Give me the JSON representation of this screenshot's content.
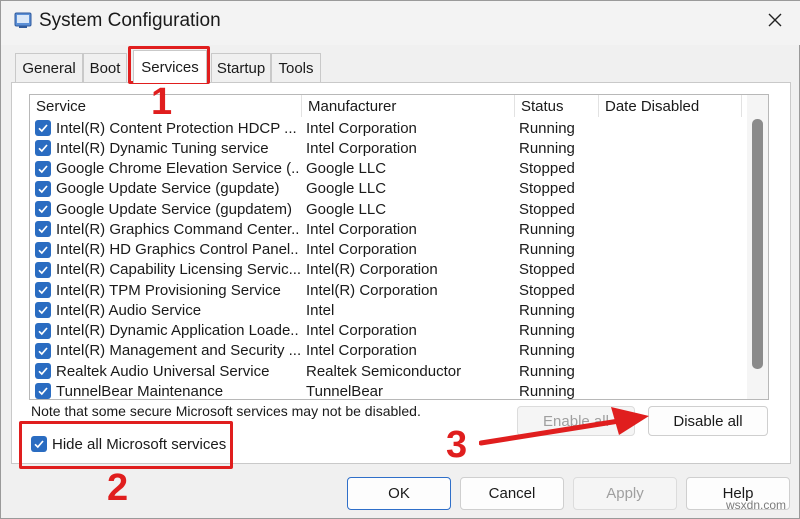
{
  "window": {
    "title": "System Configuration"
  },
  "tabs": [
    "General",
    "Boot",
    "Services",
    "Startup",
    "Tools"
  ],
  "active_tab": "Services",
  "columns": [
    "Service",
    "Manufacturer",
    "Status",
    "Date Disabled"
  ],
  "rows": [
    {
      "service": "Intel(R) Content Protection HDCP ...",
      "manufacturer": "Intel Corporation",
      "status": "Running",
      "date": ""
    },
    {
      "service": "Intel(R) Dynamic Tuning service",
      "manufacturer": "Intel Corporation",
      "status": "Running",
      "date": ""
    },
    {
      "service": "Google Chrome Elevation Service (...",
      "manufacturer": "Google LLC",
      "status": "Stopped",
      "date": ""
    },
    {
      "service": "Google Update Service (gupdate)",
      "manufacturer": "Google LLC",
      "status": "Stopped",
      "date": ""
    },
    {
      "service": "Google Update Service (gupdatem)",
      "manufacturer": "Google LLC",
      "status": "Stopped",
      "date": ""
    },
    {
      "service": "Intel(R) Graphics Command Center...",
      "manufacturer": "Intel Corporation",
      "status": "Running",
      "date": ""
    },
    {
      "service": "Intel(R) HD Graphics Control Panel...",
      "manufacturer": "Intel Corporation",
      "status": "Running",
      "date": ""
    },
    {
      "service": "Intel(R) Capability Licensing Servic...",
      "manufacturer": "Intel(R) Corporation",
      "status": "Stopped",
      "date": ""
    },
    {
      "service": "Intel(R) TPM Provisioning Service",
      "manufacturer": "Intel(R) Corporation",
      "status": "Stopped",
      "date": ""
    },
    {
      "service": "Intel(R) Audio Service",
      "manufacturer": "Intel",
      "status": "Running",
      "date": ""
    },
    {
      "service": "Intel(R) Dynamic Application Loade...",
      "manufacturer": "Intel Corporation",
      "status": "Running",
      "date": ""
    },
    {
      "service": "Intel(R) Management and Security ...",
      "manufacturer": "Intel Corporation",
      "status": "Running",
      "date": ""
    },
    {
      "service": "Realtek Audio Universal Service",
      "manufacturer": "Realtek Semiconductor",
      "status": "Running",
      "date": ""
    },
    {
      "service": "TunnelBear Maintenance",
      "manufacturer": "TunnelBear",
      "status": "Running",
      "date": ""
    }
  ],
  "note": "Note that some secure Microsoft services may not be disabled.",
  "enable_all": "Enable all",
  "disable_all": "Disable all",
  "hide_ms_label": "Hide all Microsoft services",
  "hide_ms_checked": true,
  "footer": {
    "ok": "OK",
    "cancel": "Cancel",
    "apply": "Apply",
    "help": "Help"
  },
  "annotations": {
    "n1": "1",
    "n2": "2",
    "n3": "3",
    "color": "#e01e1e"
  },
  "watermark": "wsxdn.com"
}
